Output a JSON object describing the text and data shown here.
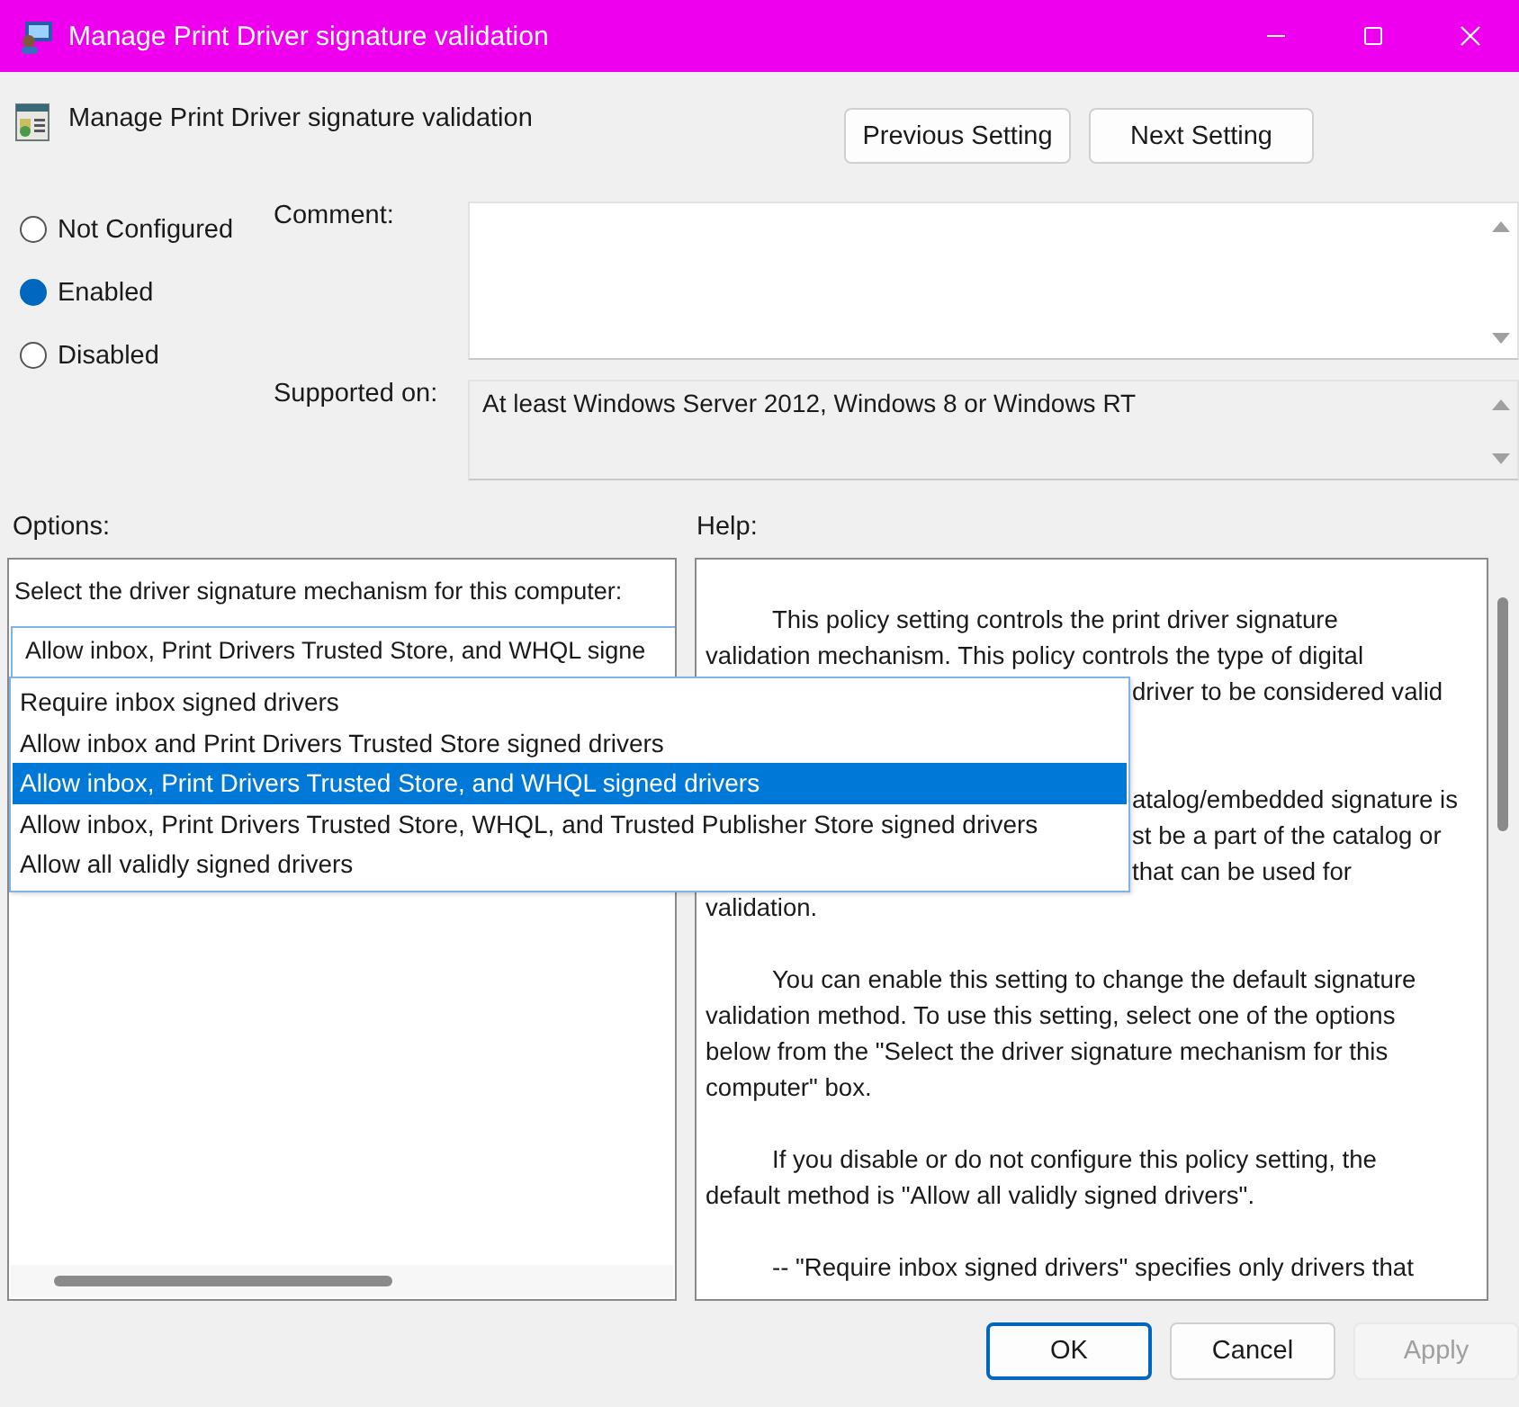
{
  "window": {
    "title": "Manage Print Driver signature validation"
  },
  "policy": {
    "title": "Manage Print Driver signature validation"
  },
  "nav_buttons": [
    {
      "label": "Previous Setting"
    },
    {
      "label": "Next Setting"
    }
  ],
  "state_options": [
    {
      "label": "Not Configured",
      "selected": false
    },
    {
      "label": "Enabled",
      "selected": true
    },
    {
      "label": "Disabled",
      "selected": false
    }
  ],
  "comment": {
    "label": "Comment:"
  },
  "supported_on": {
    "label": "Supported on:",
    "value": "At least Windows Server 2012, Windows 8 or Windows RT"
  },
  "options": {
    "label": "Options:",
    "instruction": "Select the driver signature mechanism for this computer:",
    "combo_value": "Allow inbox, Print Drivers Trusted Store, and WHQL signe",
    "dropdown": [
      {
        "label": "Require inbox signed drivers",
        "selected": false
      },
      {
        "label": "Allow inbox and Print Drivers Trusted Store signed drivers",
        "selected": false
      },
      {
        "label": "Allow inbox, Print Drivers Trusted Store, and WHQL signed drivers",
        "selected": true
      },
      {
        "label": "Allow inbox, Print Drivers Trusted Store, WHQL, and Trusted Publisher Store signed drivers",
        "selected": false
      },
      {
        "label": "Allow all validly signed drivers",
        "selected": false
      }
    ]
  },
  "help": {
    "label": "Help:",
    "lines": [
      {
        "kind": "indent",
        "text": "This policy setting controls the print driver signature"
      },
      {
        "kind": "plain",
        "text": "validation mechanism. This policy controls the type of digital"
      },
      {
        "kind": "partial",
        "text": "driver to be considered valid"
      },
      {
        "kind": "gap"
      },
      {
        "kind": "gap"
      },
      {
        "kind": "partial",
        "text": "atalog/embedded signature is"
      },
      {
        "kind": "partial",
        "text": "st be a part of the catalog or"
      },
      {
        "kind": "partial",
        "text": "that can be used for"
      },
      {
        "kind": "plain",
        "text": "validation."
      },
      {
        "kind": "gap"
      },
      {
        "kind": "indent",
        "text": "You can enable this setting to change the default signature"
      },
      {
        "kind": "plain",
        "text": "validation method. To use this setting, select one of the options"
      },
      {
        "kind": "plain",
        "text": "below from the \"Select the driver signature mechanism for this"
      },
      {
        "kind": "plain",
        "text": "computer\" box."
      },
      {
        "kind": "gap"
      },
      {
        "kind": "indent",
        "text": "If you disable or do not configure this policy setting, the"
      },
      {
        "kind": "plain",
        "text": "default method is \"Allow all validly signed drivers\"."
      },
      {
        "kind": "gap"
      },
      {
        "kind": "indent",
        "text": "-- \"Require inbox signed drivers\" specifies only drivers that"
      }
    ]
  },
  "buttons": [
    {
      "label": "OK",
      "kind": "default",
      "disabled": false
    },
    {
      "label": "Cancel",
      "kind": "normal",
      "disabled": false
    },
    {
      "label": "Apply",
      "kind": "normal",
      "disabled": true
    }
  ]
}
